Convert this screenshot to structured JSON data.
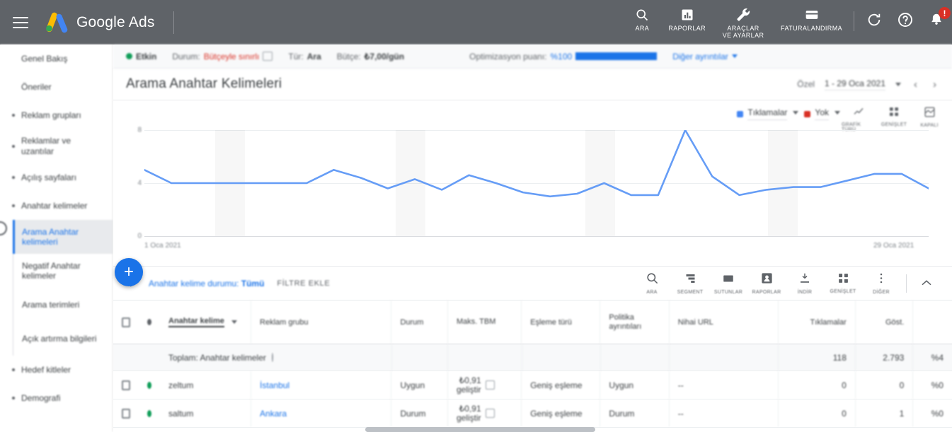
{
  "topbar": {
    "brand": "Google Ads",
    "menu_icon": "hamburger-icon",
    "tools": [
      {
        "icon": "search-icon",
        "label": "ARA"
      },
      {
        "icon": "reports-bar-chart-icon",
        "label": "RAPORLAR"
      },
      {
        "icon": "wrench-icon",
        "label": "ARAÇLAR\nVE AYARLAR"
      },
      {
        "icon": "credit-card-icon",
        "label": "FATURALANDIRMA"
      }
    ],
    "refresh_icon": "refresh-icon",
    "help_icon": "help-question-icon",
    "notifications_icon": "bell-icon",
    "notification_badge": "!"
  },
  "sidebar": {
    "items": [
      {
        "label": "Genel Bakış",
        "bullet": false
      },
      {
        "label": "Öneriler",
        "bullet": false
      },
      {
        "label": "Reklam grupları",
        "bullet": true
      },
      {
        "label": "Reklamlar ve uzantılar",
        "bullet": true
      },
      {
        "label": "Açılış sayfaları",
        "bullet": true
      },
      {
        "label": "Anahtar kelimeler",
        "bullet": true
      }
    ],
    "sub_items": [
      {
        "label": "Arama Anahtar kelimeleri",
        "active": true
      },
      {
        "label": "Negatif Anahtar kelimeler",
        "active": false
      },
      {
        "label": "Arama terimleri",
        "active": false
      },
      {
        "label": "Açık artırma bilgileri",
        "active": false
      }
    ],
    "items_after": [
      {
        "label": "Hedef kitleler",
        "bullet": true
      },
      {
        "label": "Demografi",
        "bullet": true
      }
    ],
    "fab_label": "+"
  },
  "status_strip": {
    "state": "Etkin",
    "status_label": "Durum:",
    "status_value": "Bütçeyle sınırlı",
    "type_label": "Tür:",
    "type_value": "Ara",
    "budget_label": "Bütçe:",
    "budget_value": "₺7,00/gün",
    "opt_label": "Optimizasyon puanı:",
    "opt_value": "%100",
    "more_details": "Diğer ayrıntılar"
  },
  "page": {
    "title": "Arama Anahtar Kelimeleri",
    "date_prefix": "Özel",
    "date_range": "1 - 29 Oca 2021",
    "prev_arrow": "‹",
    "next_arrow": "›"
  },
  "chart_data": {
    "type": "line",
    "title": "",
    "xlabel": "",
    "ylabel": "",
    "ylim": [
      0,
      8
    ],
    "yticks": [
      8,
      4,
      0
    ],
    "grid": true,
    "legend_position": "top-right",
    "x_start_label": "1 Oca 2021",
    "x_end_label": "29 Oca 2021",
    "series": [
      {
        "name": "Tıklamalar",
        "color": "#669df6",
        "values": [
          5,
          4,
          4,
          4,
          4,
          4,
          4,
          5,
          4.4,
          3.6,
          4.3,
          3.5,
          4.6,
          4,
          3.3,
          3,
          3.2,
          4,
          3.1,
          3.1,
          8,
          4.5,
          3.1,
          3.5,
          3.7,
          3.7,
          4.2,
          4.7,
          4.7,
          3.6
        ]
      },
      {
        "name": "Yok",
        "color": "#d93025",
        "values": []
      }
    ]
  },
  "chart_tools": [
    {
      "icon": "trendline-icon",
      "label": "GRAFİK TÜRÜ"
    },
    {
      "icon": "expand-icon",
      "label": "GENİŞLET"
    },
    {
      "icon": "overlay-icon",
      "label": "KAPALI"
    }
  ],
  "filter_bar": {
    "filter_icon": "funnel-icon",
    "chip_label": "Anahtar kelime durumu:",
    "chip_value": "Tümü",
    "add_filter": "FİLTRE EKLE",
    "tools": [
      {
        "icon": "search-icon",
        "label": "ARA"
      },
      {
        "icon": "segment-icon",
        "label": "SEGMENT"
      },
      {
        "icon": "columns-icon",
        "label": "SÜTUNLAR"
      },
      {
        "icon": "reports-icon",
        "label": "RAPORLAR"
      },
      {
        "icon": "download-icon",
        "label": "İNDİR"
      },
      {
        "icon": "expand-icon",
        "label": "GENİŞLET"
      },
      {
        "icon": "more-vert-icon",
        "label": "DİĞER"
      }
    ],
    "collapse_icon": "chevron-up-icon"
  },
  "table": {
    "headers": {
      "checkbox": "select-all",
      "status": "status",
      "keyword": "Anahtar kelime",
      "ad_group": "Reklam grubu",
      "state": "Durum",
      "max_cpc": "Maks. TBM",
      "match_type": "Eşleme türü",
      "policy": "Politika ayrıntıları",
      "final_url": "Nihai URL",
      "clicks": "Tıklamalar",
      "impressions": "Göst."
    },
    "totals": {
      "label": "Toplam: Anahtar kelimeler",
      "clicks": "118",
      "impressions": "2.793",
      "last": "%4"
    },
    "rows": [
      {
        "keyword": "zeltum",
        "ad_group": "İstanbul",
        "state": "Uygun",
        "max_cpc": "₺0,91",
        "max_cpc_sub": "geliştir",
        "match_type": "Geniş eşleme",
        "policy": "Uygun",
        "final_url": "--",
        "clicks": "0",
        "impressions": "0",
        "last": "%0"
      },
      {
        "keyword": "saltum",
        "ad_group": "Ankara",
        "state": "Durum",
        "max_cpc": "₺0,91",
        "max_cpc_sub": "geliştir",
        "match_type": "Geniş eşleme",
        "policy": "Durum",
        "final_url": "--",
        "clicks": "0",
        "impressions": "1",
        "last": "%0"
      }
    ]
  }
}
